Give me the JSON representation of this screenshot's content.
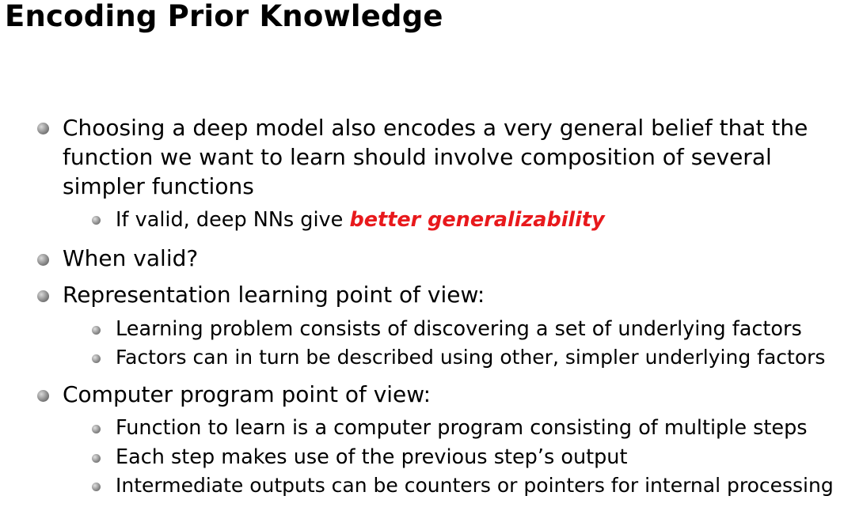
{
  "slide": {
    "title": "Encoding Prior Knowledge",
    "emphasis_color": "#e8191c",
    "bullets": [
      {
        "lines": [
          "Choosing a deep model also encodes a very general belief that the",
          "function we want to learn should involve composition of several",
          "simpler functions"
        ],
        "sub": [
          {
            "text": "If valid, deep NNs give ",
            "emphasis": "better generalizability"
          }
        ]
      },
      {
        "lines": [
          "When valid?"
        ],
        "sub": []
      },
      {
        "lines": [
          "Representation learning point of view:"
        ],
        "sub": [
          {
            "text": "Learning problem consists of discovering a set of underlying factors"
          },
          {
            "text": "Factors can in turn be described using other, simpler underlying factors"
          }
        ]
      },
      {
        "lines": [
          "Computer program point of view:"
        ],
        "sub": [
          {
            "text": "Function to learn is a computer program consisting of multiple steps"
          },
          {
            "text": "Each step makes use of the previous step’s output"
          },
          {
            "text": "Intermediate outputs can be counters or pointers for internal processing"
          }
        ]
      }
    ]
  }
}
